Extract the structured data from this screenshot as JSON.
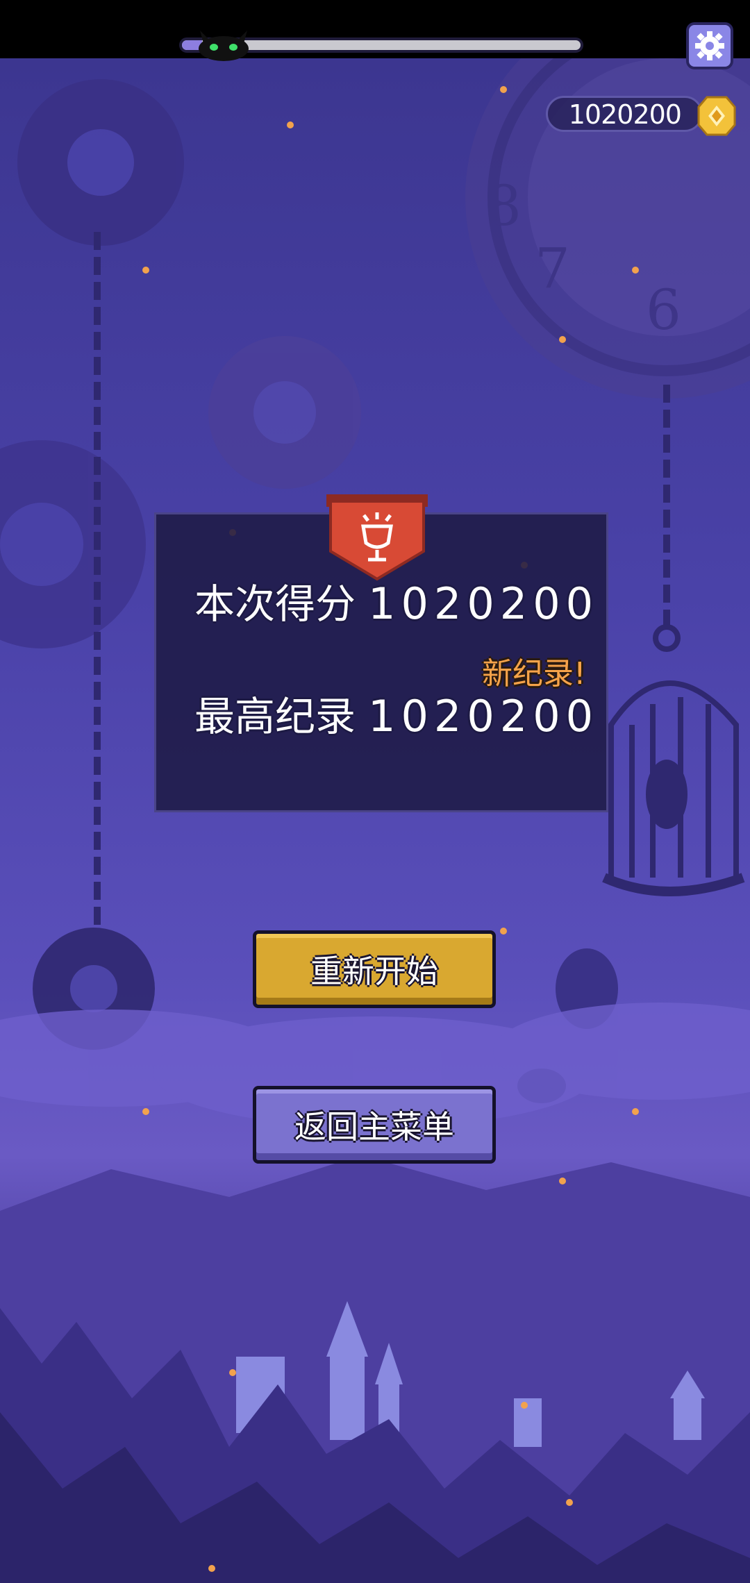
{
  "hud": {
    "progress": 0.05,
    "coins": "1020200",
    "icons": {
      "settings": "gear-icon",
      "coin": "coin-icon",
      "player_marker": "black-cat-icon"
    }
  },
  "result": {
    "score_label": "本次得分",
    "score_value": "1020200",
    "new_record_badge": "新纪录!",
    "best_label": "最高纪录",
    "best_value": "1020200",
    "badge_icon": "trophy-icon"
  },
  "buttons": {
    "restart": "重新开始",
    "main_menu": "返回主菜单"
  },
  "colors": {
    "restart_button": "#d9a830",
    "menu_button": "#7b72cf",
    "new_record": "#f6a34a",
    "ribbon": "#d84a35"
  }
}
